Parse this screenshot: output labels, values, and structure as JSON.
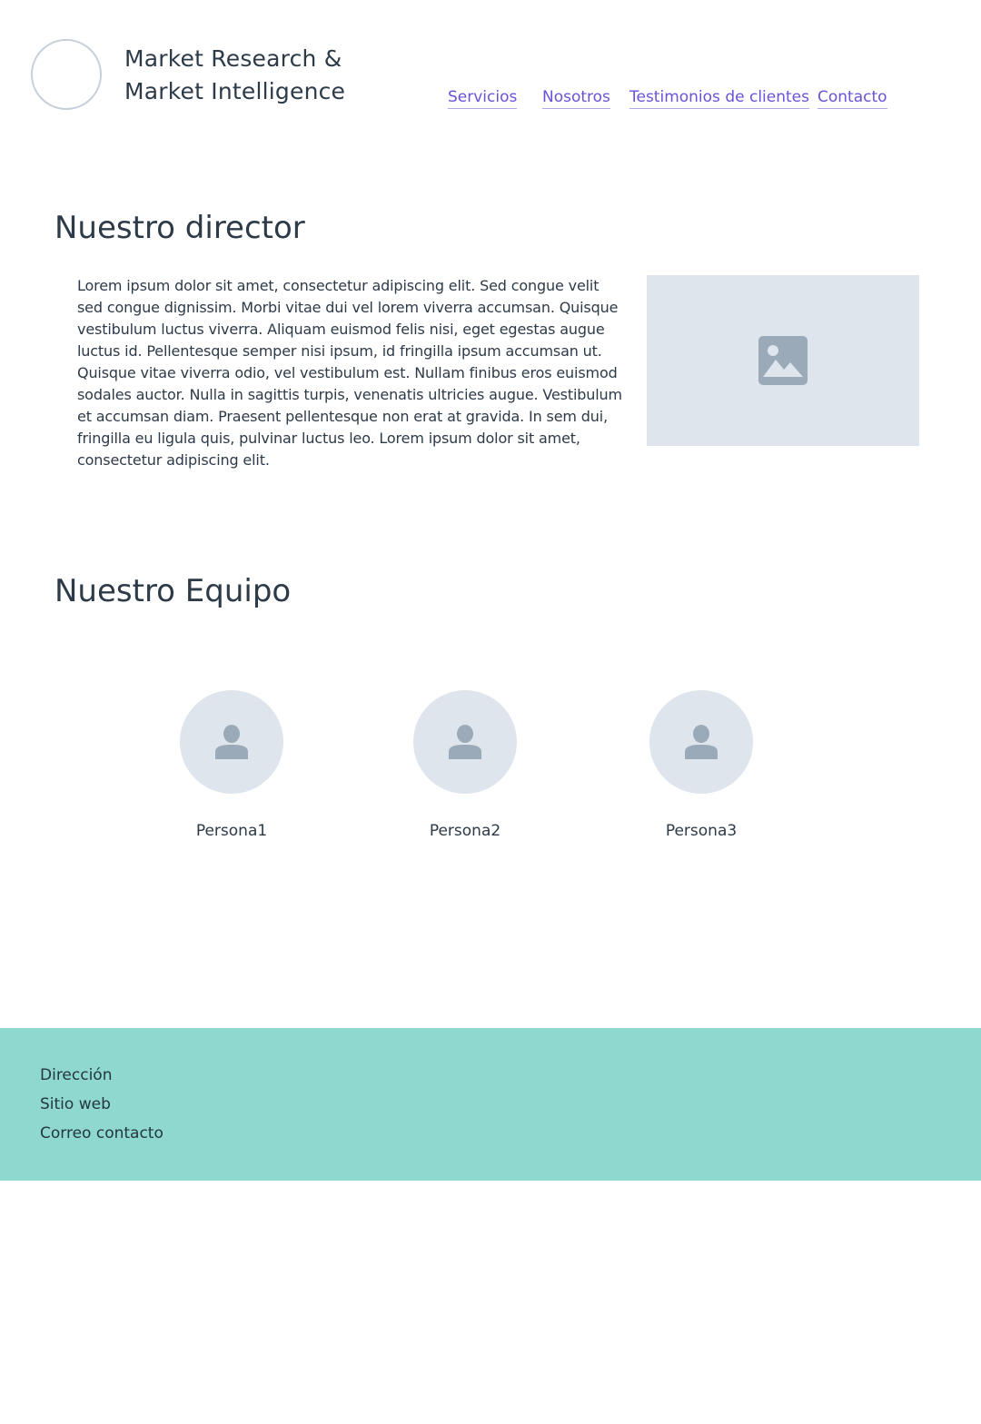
{
  "header": {
    "brand_line1": "Market Research &",
    "brand_line2": "Market Intelligence",
    "nav": [
      {
        "label": "Servicios"
      },
      {
        "label": "Nosotros"
      },
      {
        "label": "Testimonios de clientes"
      },
      {
        "label": "Contacto"
      }
    ]
  },
  "director": {
    "title": "Nuestro director",
    "text": "Lorem ipsum dolor sit amet, consectetur adipiscing elit. Sed congue velit sed congue dignissim. Morbi vitae dui vel lorem viverra accumsan. Quisque vestibulum luctus viverra. Aliquam euismod felis nisi, eget egestas augue luctus id. Pellentesque semper nisi ipsum, id fringilla ipsum accumsan ut. Quisque vitae viverra odio, vel vestibulum est. Nullam finibus eros euismod sodales auctor. Nulla in sagittis turpis, venenatis ultricies augue. Vestibulum et accumsan diam. Praesent pellentesque non erat at gravida. In sem dui, fringilla eu ligula quis, pulvinar luctus leo. Lorem ipsum dolor sit amet, consectetur adipiscing elit.",
    "image_icon": "image-placeholder-icon"
  },
  "team": {
    "title": "Nuestro Equipo",
    "members": [
      {
        "name": "Persona1",
        "icon": "person-icon"
      },
      {
        "name": "Persona2",
        "icon": "person-icon"
      },
      {
        "name": "Persona3",
        "icon": "person-icon"
      }
    ]
  },
  "footer": {
    "address": "Dirección",
    "website": "Sitio web",
    "email": "Correo contacto"
  },
  "colors": {
    "text": "#2d3a48",
    "link": "#6b52d6",
    "placeholder_bg": "#dfe5ed",
    "placeholder_icon": "#9aaab8",
    "footer_bg": "#8fd8cf"
  }
}
